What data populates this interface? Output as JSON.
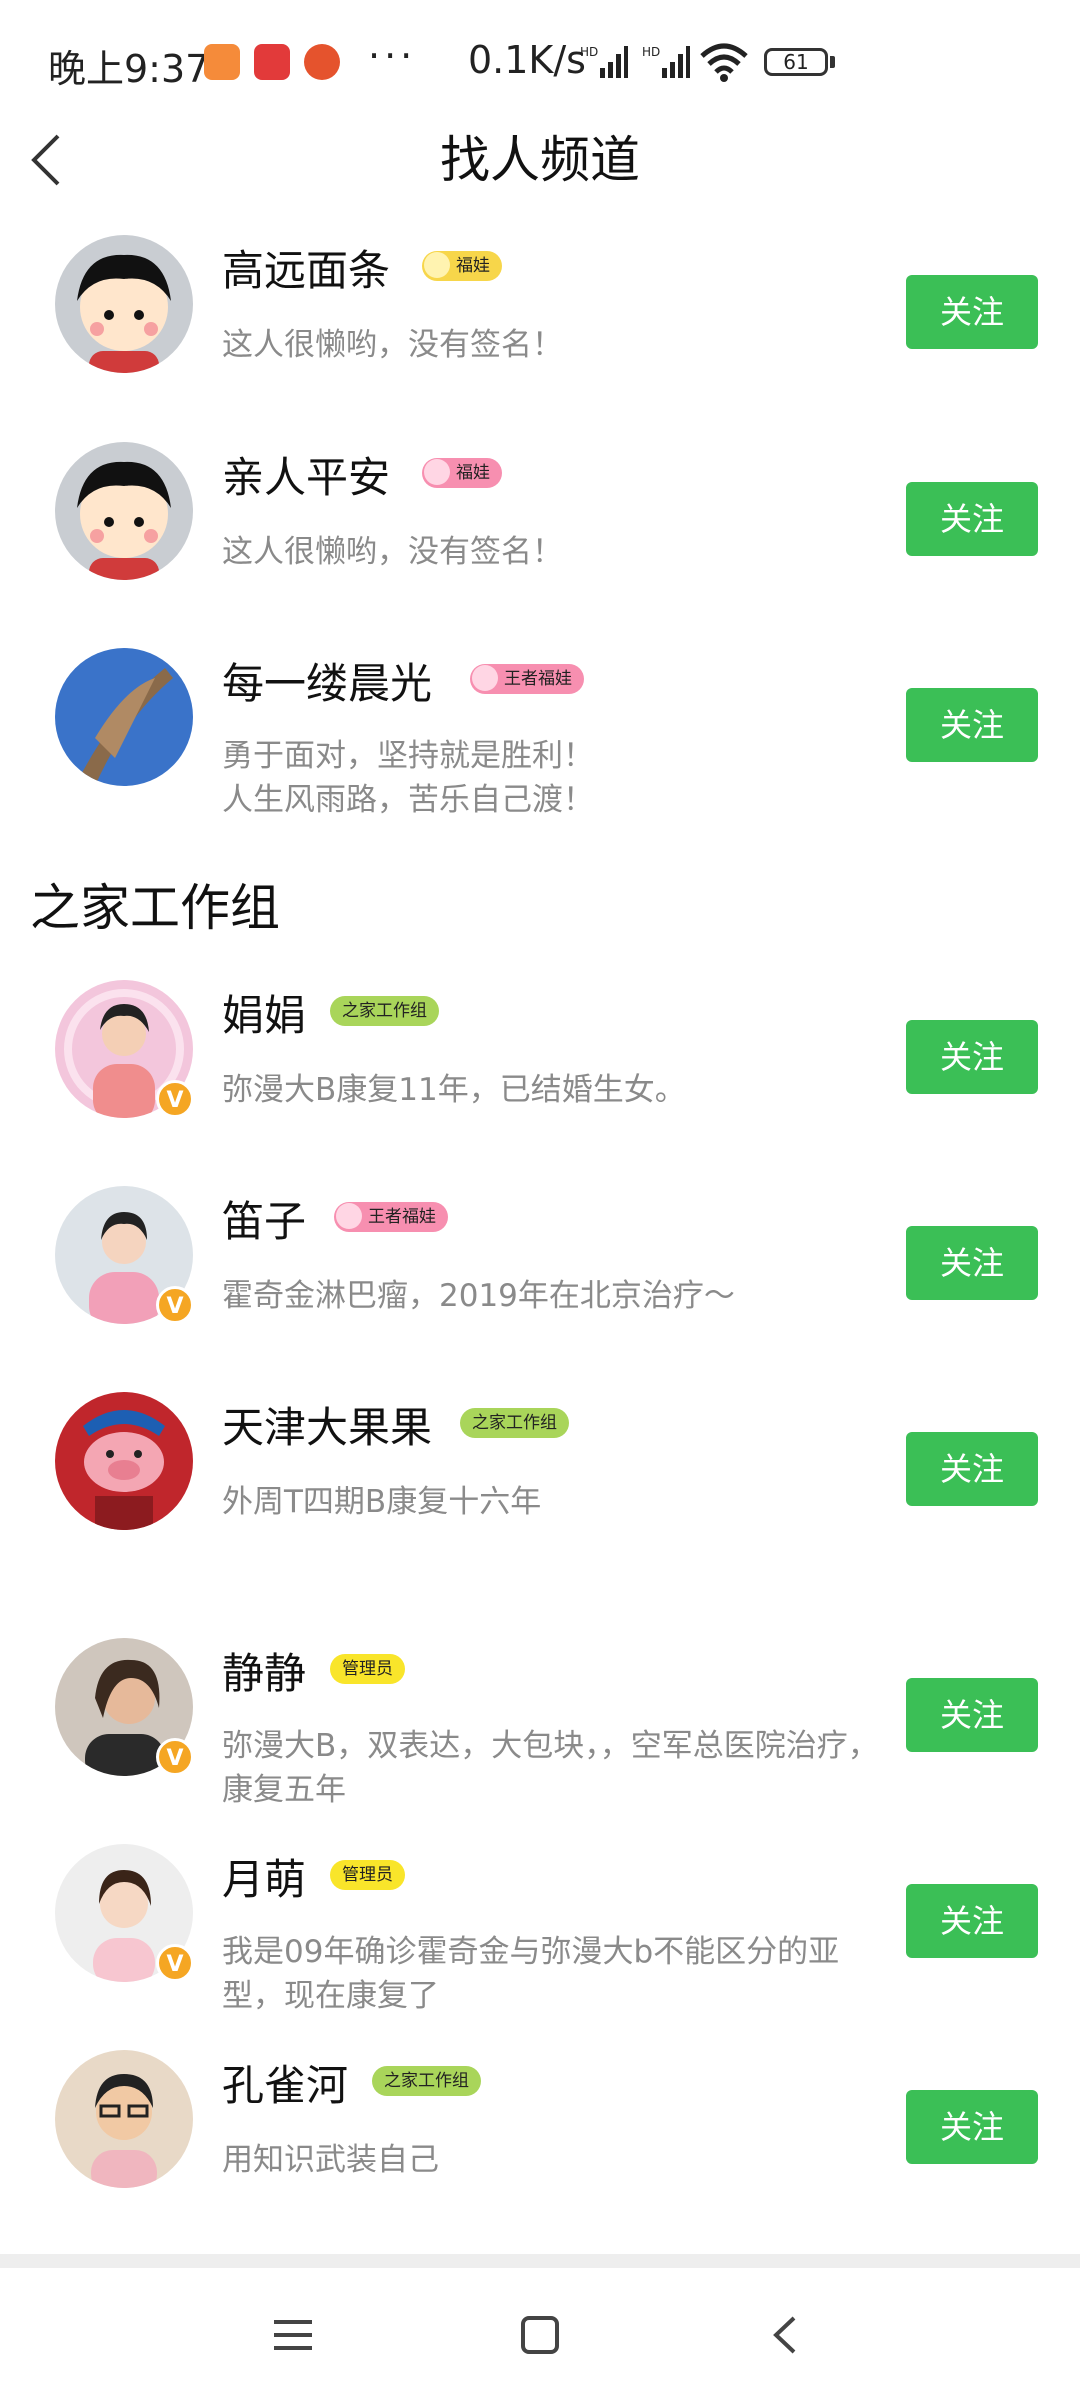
{
  "status_bar": {
    "time": "晚上9:37",
    "network_speed": "0.1K/s",
    "sig1": "HD",
    "sig2": "HD",
    "battery": "61",
    "more": "···"
  },
  "header": {
    "title": "找人频道"
  },
  "users_top": [
    {
      "name": "高远面条",
      "tag": "福娃",
      "tag_color": "#f7d64a",
      "bio": "这人很懒哟，没有签名！"
    },
    {
      "name": "亲人平安",
      "tag": "福娃",
      "tag_color": "#f78fb0",
      "bio": "这人很懒哟，没有签名！"
    },
    {
      "name": "每一缕晨光",
      "tag": "王者福娃",
      "tag_color": "#f78fb0",
      "bio": "勇于面对，坚持就是胜利！\n人生风雨路，苦乐自己渡！"
    }
  ],
  "section": {
    "title": "之家工作组"
  },
  "users_group": [
    {
      "name": "娟娟",
      "tag": "之家工作组",
      "tag_color": "#a9d55a",
      "bio": "弥漫大B康复11年，已结婚生女。"
    },
    {
      "name": "笛子",
      "tag": "王者福娃",
      "tag_color": "#f78fb0",
      "bio": "霍奇金淋巴瘤，2019年在北京治疗～"
    },
    {
      "name": "天津大果果",
      "tag": "之家工作组",
      "tag_color": "#a9d55a",
      "bio": "外周T四期B康复十六年"
    },
    {
      "name": "静静",
      "tag": "管理员",
      "tag_color": "#f9e52a",
      "bio": "弥漫大B，双表达，大包块，，空军总医院治疗，康复五年"
    },
    {
      "name": "月萌",
      "tag": "管理员",
      "tag_color": "#f9e52a",
      "bio": "我是09年确诊霍奇金与弥漫大b不能区分的亚型，现在康复了"
    },
    {
      "name": "孔雀河",
      "tag": "之家工作组",
      "tag_color": "#a9d55a",
      "bio": "用知识武装自己"
    }
  ],
  "follow_label": "关注",
  "verified_mark": "V",
  "colors": {
    "follow_button": "#3bbf56",
    "verified_badge": "#f5a623"
  },
  "icons": [
    "back-arrow-icon",
    "menu-icon",
    "home-square-icon",
    "back-triangle-icon",
    "wifi-icon",
    "signal-icon",
    "battery-icon"
  ]
}
